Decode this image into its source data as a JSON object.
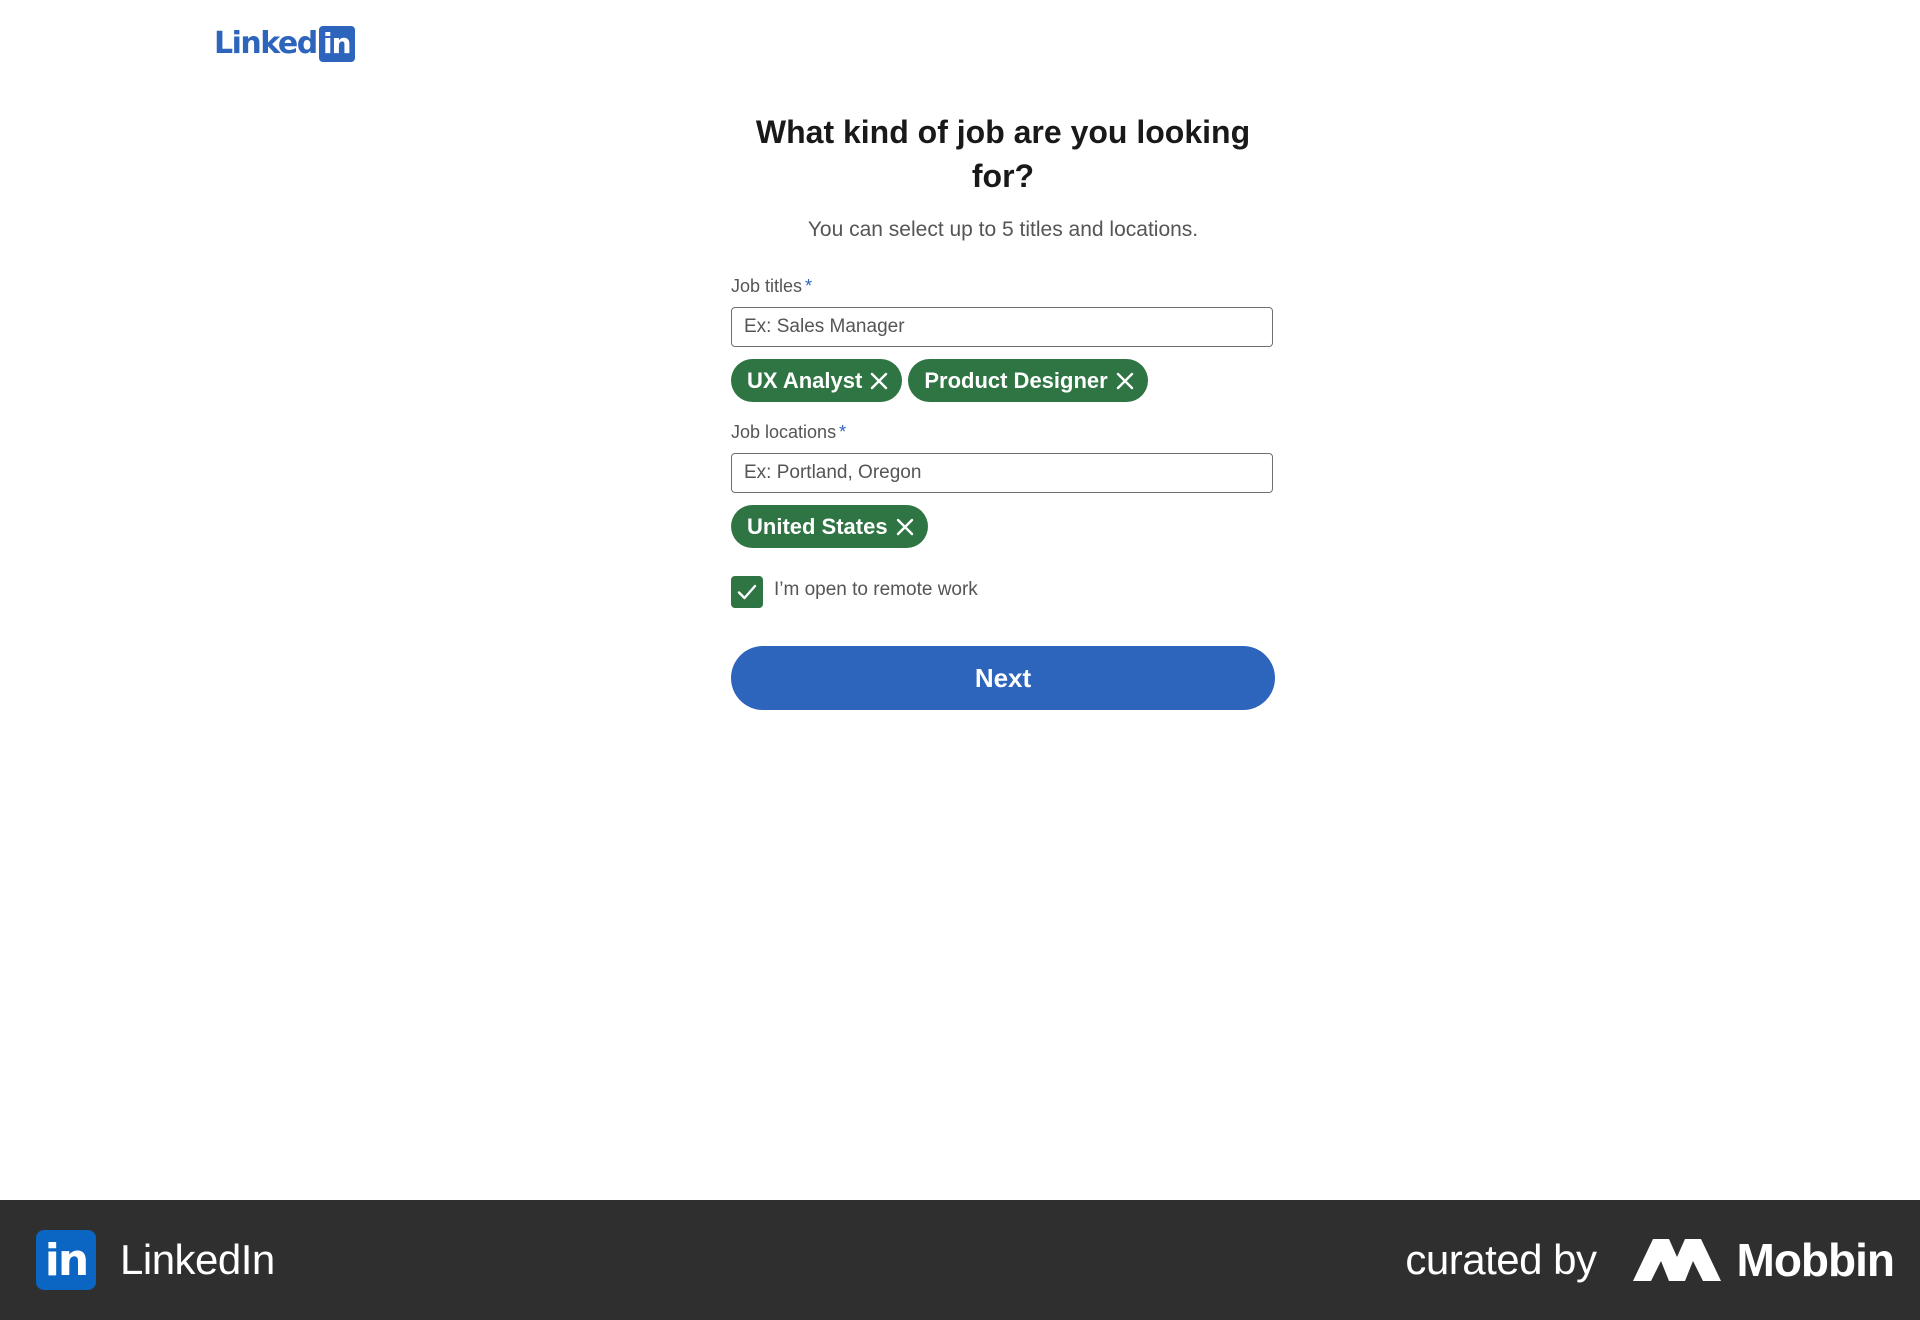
{
  "header": {
    "logo_word": "Linked",
    "logo_box": "in"
  },
  "page": {
    "title": "What kind of job are you looking for?",
    "subtitle": "You can select up to 5 titles and locations."
  },
  "job_titles": {
    "label": "Job titles",
    "required_mark": "*",
    "placeholder": "Ex: Sales Manager",
    "value": "",
    "selected": [
      "UX Analyst",
      "Product Designer"
    ]
  },
  "job_locations": {
    "label": "Job locations",
    "required_mark": "*",
    "placeholder": "Ex: Portland, Oregon",
    "value": "",
    "selected": [
      "United States"
    ]
  },
  "remote": {
    "label": "I’m open to remote work",
    "checked": true
  },
  "next_label": "Next",
  "footer": {
    "app_logo": "in",
    "app_name": "LinkedIn",
    "curated_by": "curated by",
    "curator_name": "Mobbin"
  },
  "colors": {
    "brand_blue": "#2d64bc",
    "pill_green": "#2f7543",
    "footer_bg": "#2f2f2f"
  },
  "icons": {
    "pill_remove": "close-icon",
    "checkbox": "checkmark-icon",
    "curator_logo": "mobbin-logo-icon"
  }
}
